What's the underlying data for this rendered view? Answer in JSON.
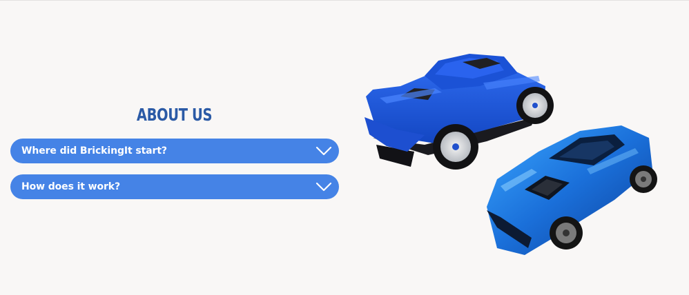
{
  "about": {
    "title": "ABOUT US"
  },
  "faq": [
    {
      "question": "Where did BrickingIt start?",
      "expanded": false
    },
    {
      "question": "How does it work?",
      "expanded": false
    }
  ],
  "icons": {
    "toggle": "chevron-down-icon"
  },
  "colors": {
    "background": "#f9f7f6",
    "title": "#2b5aa6",
    "accordion": "#4583e6",
    "accordion_text": "#ffffff"
  },
  "images": {
    "hero": "lego-car-and-die-cast-car-photo"
  }
}
